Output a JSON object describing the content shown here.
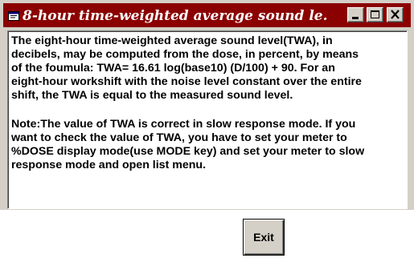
{
  "window": {
    "title": "8-hour time-weighted average sound le...",
    "title_bar_color": "#8b0000",
    "controls": {
      "minimize_icon": "minimize-icon",
      "maximize_icon": "maximize-icon",
      "close_icon": "close-icon"
    }
  },
  "content": {
    "paragraph1": "The eight-hour time-weighted average sound level(TWA), in\ndecibels, may be computed from the dose, in percent, by means\nof the foumula: TWA= 16.61 log(base10) (D/100) + 90. For an\neight-hour workshift with the noise level constant over the entire\nshift, the TWA is equal to the measured sound level.",
    "paragraph2": "Note:The value of TWA is correct in slow response mode. If you\nwant to check the value of TWA, you have to set your meter to\n%DOSE display mode(use MODE key) and set your meter to slow\nresponse mode and open list menu."
  },
  "buttons": {
    "exit_label": "Exit"
  }
}
